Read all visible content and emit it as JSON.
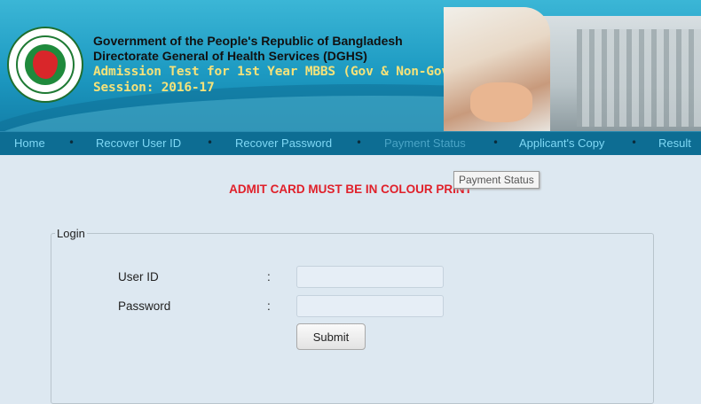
{
  "header": {
    "org_line1": "Government of the People's Republic of Bangladesh",
    "org_line2": "Directorate General of Health Services (DGHS)",
    "exam_line1": "Admission Test for 1st Year MBBS (Gov & Non-Gov)",
    "exam_line2": "Session: 2016-17",
    "logo_icon": "government-seal-icon"
  },
  "nav": {
    "items": [
      {
        "label": "Home"
      },
      {
        "label": "Recover User ID"
      },
      {
        "label": "Recover Password"
      },
      {
        "label": "Payment Status"
      },
      {
        "label": "Applicant's Copy"
      },
      {
        "label": "Result"
      }
    ],
    "separator": "•"
  },
  "tooltip": "Payment Status",
  "notice": "ADMIT CARD MUST BE IN COLOUR PRINT",
  "login": {
    "legend": "Login",
    "user_id_label": "User ID",
    "password_label": "Password",
    "colon": ":",
    "user_id_value": "",
    "password_value": "",
    "submit_label": "Submit"
  },
  "colors": {
    "nav_bg": "#0d6d93",
    "nav_link": "#7fd8f5",
    "notice": "#e0202a",
    "page_bg": "#dde8f1"
  }
}
